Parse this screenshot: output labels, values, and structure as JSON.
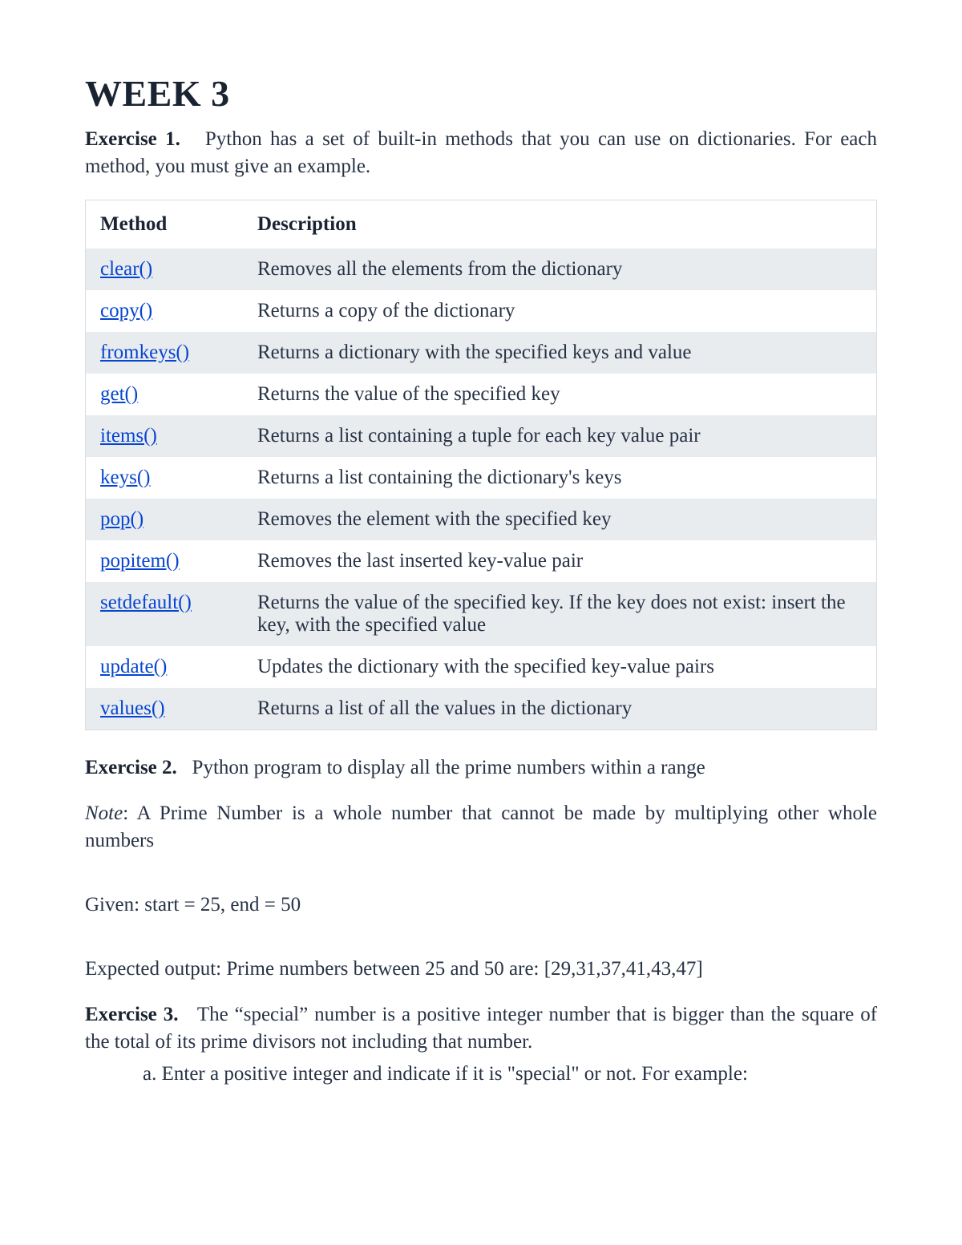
{
  "title": "WEEK 3",
  "exercises": {
    "ex1": {
      "label": "Exercise 1.",
      "text": "Python has a set of built-in methods that you can use on dictionaries. For each method, you must give an example."
    },
    "ex2": {
      "label": "Exercise 2.",
      "text": "Python program to display all the prime numbers within a range",
      "note_label": "Note",
      "note_text": ": A Prime Number is a whole number that cannot be made by multiplying other whole numbers",
      "given": "Given: start = 25, end = 50",
      "expected": "Expected output:  Prime numbers between 25 and 50 are: [29,31,37,41,43,47]"
    },
    "ex3": {
      "label": "Exercise 3.",
      "text": "The “special” number is a positive integer number that is bigger than the square of the total of its prime divisors not including that number.",
      "item_a": "a.  Enter a positive integer and indicate if it is \"special\" or not. For example:"
    }
  },
  "table": {
    "headers": {
      "method": "Method",
      "description": "Description"
    },
    "rows": [
      {
        "method": "clear()",
        "description": "Removes all the elements from the dictionary"
      },
      {
        "method": "copy()",
        "description": "Returns a copy of the dictionary"
      },
      {
        "method": "fromkeys()",
        "description": "Returns a dictionary with the specified keys and value"
      },
      {
        "method": "get()",
        "description": "Returns the value of the specified key"
      },
      {
        "method": "items()",
        "description": "Returns a list containing a tuple for each key value pair"
      },
      {
        "method": "keys()",
        "description": "Returns a list containing the dictionary's keys"
      },
      {
        "method": "pop()",
        "description": "Removes the element with the specified key"
      },
      {
        "method": "popitem()",
        "description": "Removes the last inserted key-value pair"
      },
      {
        "method": "setdefault()",
        "description": "Returns the value of the specified key. If the key does not exist: insert the key, with the specified value"
      },
      {
        "method": "update()",
        "description": "Updates the dictionary with the specified key-value pairs"
      },
      {
        "method": "values()",
        "description": "Returns a list of all the values in the dictionary"
      }
    ]
  }
}
